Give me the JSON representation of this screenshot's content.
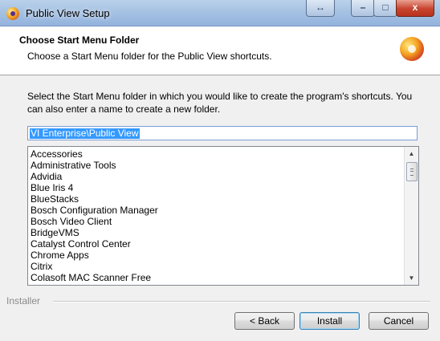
{
  "window": {
    "title": "Public View Setup",
    "swap_icon": "↔",
    "minimize_icon": "–",
    "maximize_icon": "□",
    "close_icon": "x"
  },
  "header": {
    "title": "Choose Start Menu Folder",
    "subtitle": "Choose a Start Menu folder for the Public View shortcuts."
  },
  "body": {
    "description": "Select the Start Menu folder in which you would like to create the program's shortcuts. You can also enter a name to create a new folder.",
    "folder_input": {
      "value": "VI Enterprise\\Public View"
    },
    "folders": [
      "Accessories",
      "Administrative Tools",
      "Advidia",
      "Blue Iris 4",
      "BlueStacks",
      "Bosch Configuration Manager",
      "Bosch Video Client",
      "BridgeVMS",
      "Catalyst Control Center",
      "Chrome Apps",
      "Citrix",
      "Colasoft MAC Scanner Free"
    ],
    "scroll_up_icon": "▲",
    "scroll_down_icon": "▼"
  },
  "footer": {
    "installer_label": "Installer",
    "back_label": "< Back",
    "install_label": "Install",
    "cancel_label": "Cancel"
  },
  "colors": {
    "titlebar": "#a6c2e3",
    "selection": "#3399ff",
    "close_button": "#c7442f"
  }
}
